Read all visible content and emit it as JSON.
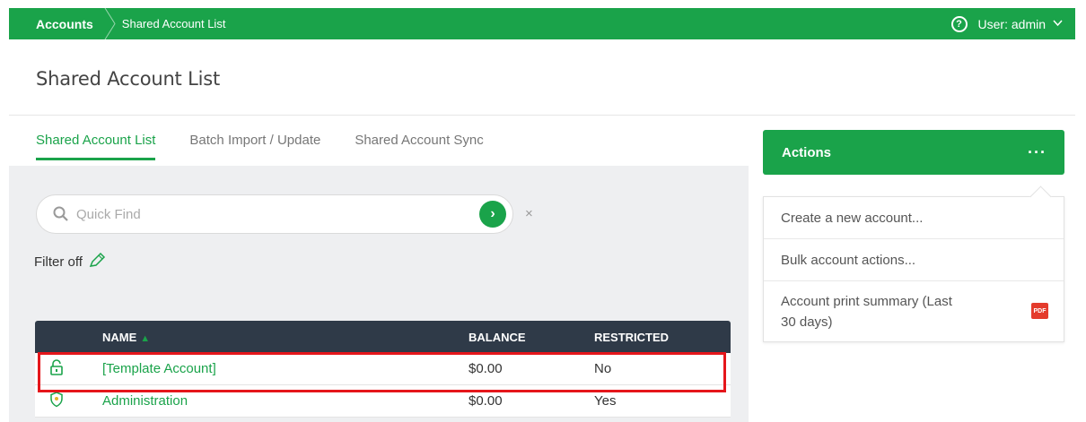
{
  "breadcrumb": {
    "root": "Accounts",
    "current": "Shared Account List"
  },
  "user": {
    "label": "User: admin",
    "help_icon": "?"
  },
  "page": {
    "title": "Shared Account List"
  },
  "tabs": [
    {
      "label": "Shared Account List",
      "active": true
    },
    {
      "label": "Batch Import / Update",
      "active": false
    },
    {
      "label": "Shared Account Sync",
      "active": false
    }
  ],
  "search": {
    "placeholder": "Quick Find",
    "value": "",
    "go": "›",
    "clear": "×"
  },
  "filter": {
    "label": "Filter off"
  },
  "table": {
    "headers": {
      "name": "NAME",
      "sort": "▲",
      "balance": "BALANCE",
      "restricted": "RESTRICTED"
    },
    "rows": [
      {
        "icon": "unlock-icon",
        "name": "[Template Account]",
        "balance": "$0.00",
        "restricted": "No"
      },
      {
        "icon": "shield-icon",
        "name": "Administration",
        "balance": "$0.00",
        "restricted": "Yes"
      }
    ]
  },
  "actions": {
    "title": "Actions",
    "more": "···",
    "items": [
      {
        "label": "Create a new account..."
      },
      {
        "label": "Bulk account actions..."
      },
      {
        "label": "Account print summary (Last 30 days)",
        "badge": "PDF"
      }
    ]
  },
  "colors": {
    "accent": "#1aa34a",
    "header_dark": "#2f3a48",
    "highlight": "#e5161b"
  }
}
